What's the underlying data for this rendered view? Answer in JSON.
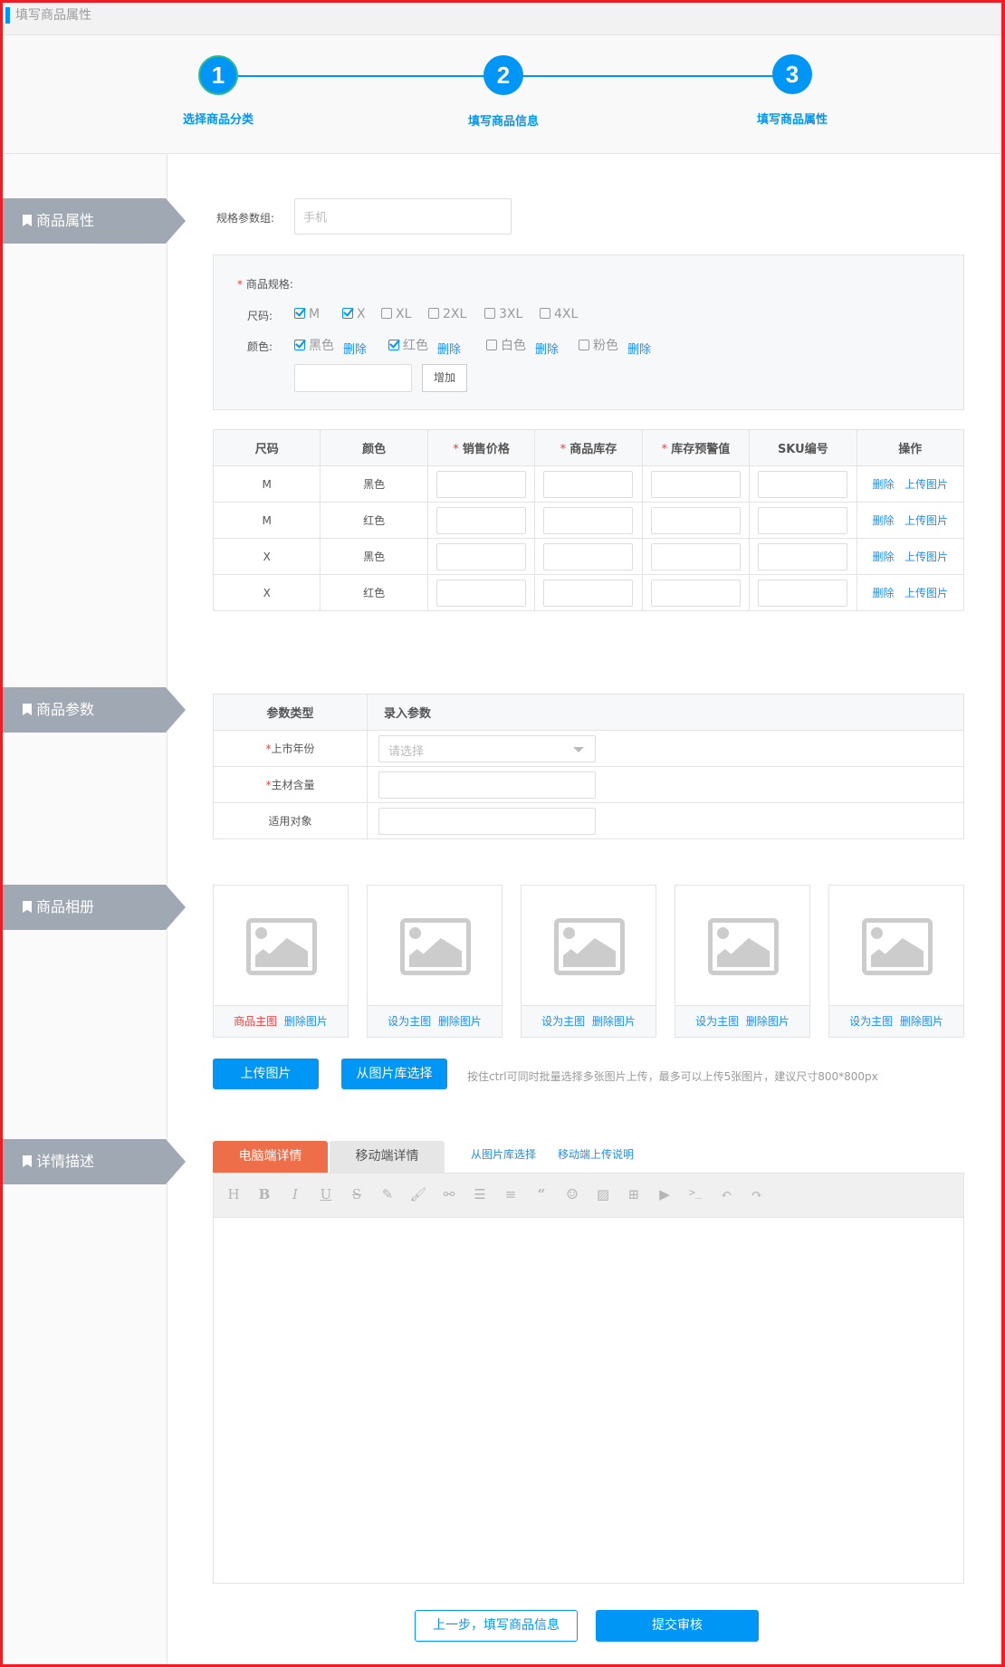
{
  "header": {
    "title": "填写商品属性"
  },
  "stepper": {
    "steps": [
      {
        "number": "1",
        "label": "选择商品分类"
      },
      {
        "number": "2",
        "label": "填写商品信息"
      },
      {
        "number": "3",
        "label": "填写商品属性"
      }
    ]
  },
  "sections": {
    "attributes": "商品属性",
    "params": "商品参数",
    "album": "商品相册",
    "details": "详情描述"
  },
  "spec_group": {
    "label": "规格参数组:",
    "placeholder": "手机"
  },
  "spec": {
    "title": "商品规格:",
    "size_label": "尺码:",
    "color_label": "颜色:",
    "sizes": [
      {
        "label": "M",
        "checked": true
      },
      {
        "label": "X",
        "checked": true
      },
      {
        "label": "XL",
        "checked": false
      },
      {
        "label": "2XL",
        "checked": false
      },
      {
        "label": "3XL",
        "checked": false
      },
      {
        "label": "4XL",
        "checked": false
      }
    ],
    "colors": [
      {
        "label": "黑色",
        "checked": true
      },
      {
        "label": "红色",
        "checked": true
      },
      {
        "label": "白色",
        "checked": false
      },
      {
        "label": "粉色",
        "checked": false
      }
    ],
    "delete_label": "删除",
    "new_color_value": "",
    "add_label": "增加"
  },
  "sku_table": {
    "headers": [
      "尺码",
      "颜色",
      "销售价格",
      "商品库存",
      "库存预警值",
      "SKU编号",
      "操作"
    ],
    "required": [
      false,
      false,
      true,
      true,
      true,
      false,
      false
    ],
    "rows": [
      {
        "size": "M",
        "color": "黑色"
      },
      {
        "size": "M",
        "color": "红色"
      },
      {
        "size": "X",
        "color": "黑色"
      },
      {
        "size": "X",
        "color": "红色"
      }
    ],
    "delete_label": "删除",
    "upload_label": "上传图片"
  },
  "params_table": {
    "headers": [
      "参数类型",
      "录入参数"
    ],
    "rows": [
      {
        "label": "上市年份",
        "required": true,
        "type": "select",
        "placeholder": "请选择"
      },
      {
        "label": "主材含量",
        "required": true,
        "type": "input",
        "value": ""
      },
      {
        "label": "适用对象",
        "required": false,
        "type": "input",
        "value": ""
      }
    ]
  },
  "album": {
    "images": [
      {
        "primary_label": "商品主图",
        "is_main": true,
        "delete_label": "删除图片"
      },
      {
        "primary_label": "设为主图",
        "is_main": false,
        "delete_label": "删除图片"
      },
      {
        "primary_label": "设为主图",
        "is_main": false,
        "delete_label": "删除图片"
      },
      {
        "primary_label": "设为主图",
        "is_main": false,
        "delete_label": "删除图片"
      },
      {
        "primary_label": "设为主图",
        "is_main": false,
        "delete_label": "删除图片"
      }
    ],
    "upload_label": "上传图片",
    "library_label": "从图片库选择",
    "hint": "按住ctrl可同时批量选择多张图片上传，最多可以上传5张图片，建议尺寸800*800px"
  },
  "details": {
    "tabs": [
      {
        "label": "电脑端详情",
        "active": true
      },
      {
        "label": "移动端详情",
        "active": false
      }
    ],
    "links": [
      "从图片库选择",
      "移动端上传说明"
    ],
    "toolbar": [
      "heading-icon",
      "bold-icon",
      "italic-icon",
      "underline-icon",
      "strikethrough-icon",
      "pen-icon",
      "brush-icon",
      "link-icon",
      "list-icon",
      "align-icon",
      "quote-icon",
      "emoji-icon",
      "image-icon",
      "table-icon",
      "video-icon",
      "code-icon",
      "undo-icon",
      "redo-icon"
    ],
    "content": ""
  },
  "footer": {
    "prev_label": "上一步，填写商品信息",
    "submit_label": "提交审核"
  },
  "colors": {
    "primary": "#0096f5",
    "danger": "#ef3c3c",
    "tab_active": "#ee6e4a",
    "section_label": "#a0a8b3"
  }
}
